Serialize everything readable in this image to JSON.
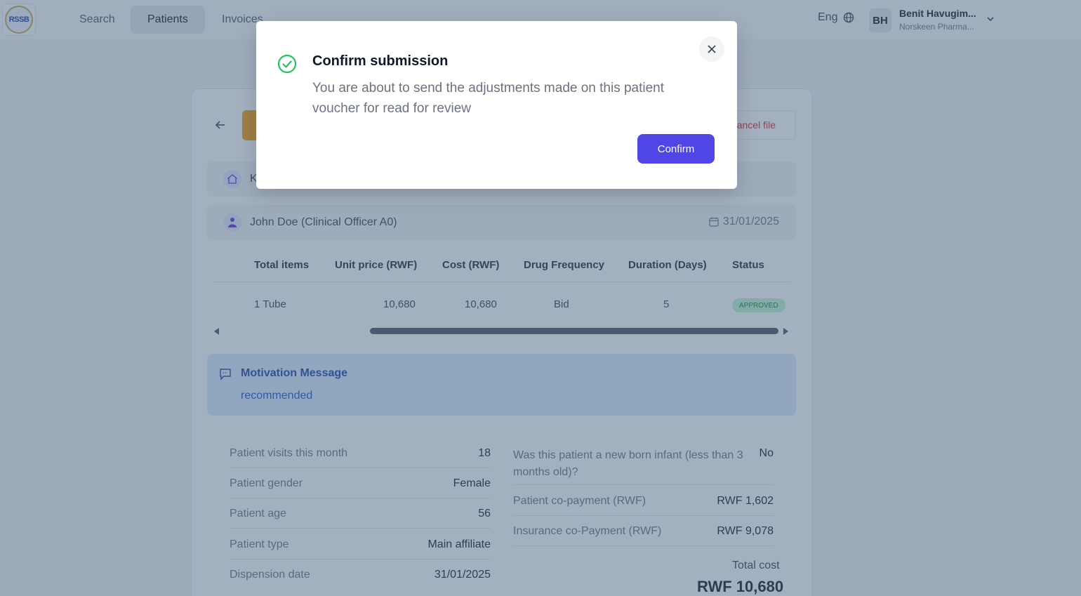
{
  "header": {
    "logo_text": "RSSB",
    "nav": [
      {
        "label": "Search"
      },
      {
        "label": "Patients"
      },
      {
        "label": "Invoices"
      }
    ],
    "language": "Eng",
    "user": {
      "initials": "BH",
      "name": "Benit Havugim...",
      "org": "Norskeen Pharma..."
    }
  },
  "page": {
    "cancel_label": "Cancel file",
    "facility_initial": "K",
    "prescriber": "John Doe (Clinical Officer A0)",
    "date": "31/01/2025"
  },
  "table": {
    "headers": [
      "Total items",
      "Unit price (RWF)",
      "Cost (RWF)",
      "Drug Frequency",
      "Duration (Days)",
      "Status"
    ],
    "row": {
      "items": "1 Tube",
      "unit_price": "10,680",
      "cost": "10,680",
      "frequency": "Bid",
      "duration": "5",
      "status": "APPROVED"
    }
  },
  "motivation": {
    "title": "Motivation Message",
    "text": "recommended"
  },
  "details_left": [
    {
      "label": "Patient visits this month",
      "value": "18"
    },
    {
      "label": "Patient gender",
      "value": "Female"
    },
    {
      "label": "Patient age",
      "value": "56"
    },
    {
      "label": "Patient type",
      "value": "Main affiliate"
    },
    {
      "label": "Dispension date",
      "value": "31/01/2025"
    }
  ],
  "details_right": {
    "newborn": {
      "label": "Was this patient a new born infant (less than 3 months old)?",
      "value": "No"
    },
    "patient_copay": {
      "label": "Patient co-payment (RWF)",
      "value": "RWF 1,602"
    },
    "insurance_copay": {
      "label": "Insurance co-Payment (RWF)",
      "value": "RWF 9,078"
    },
    "total_label": "Total cost",
    "total_value": "RWF 10,680"
  },
  "modal": {
    "title": "Confirm submission",
    "body": "You are about to send the adjustments made on this patient voucher for read for review",
    "confirm_label": "Confirm"
  },
  "colors": {
    "primary": "#4f46e5",
    "success": "#22c55e",
    "danger": "#dc2626",
    "overlay": "rgba(71,98,128,0.5)"
  }
}
